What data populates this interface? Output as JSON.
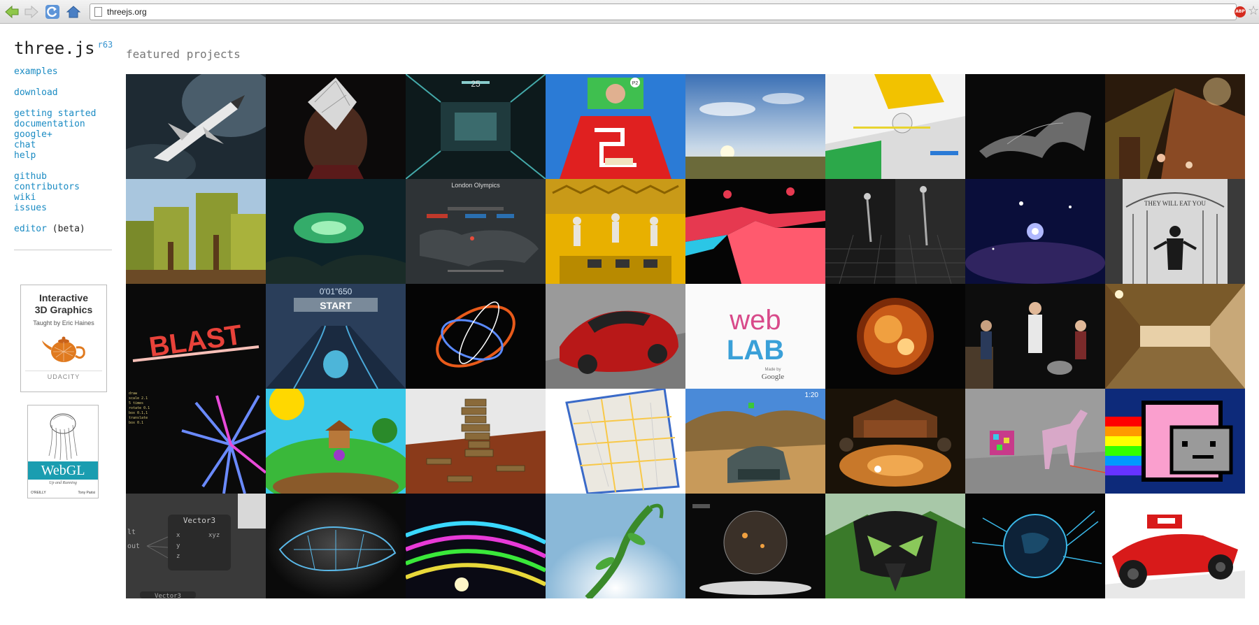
{
  "browser": {
    "url": "threejs.org",
    "abp_label": "ABP"
  },
  "sidebar": {
    "logo": "three.js",
    "version": "r63",
    "links": {
      "examples": "examples",
      "download": "download",
      "getting_started": "getting started",
      "documentation": "documentation",
      "google_plus": "google+",
      "chat": "chat",
      "help": "help",
      "github": "github",
      "contributors": "contributors",
      "wiki": "wiki",
      "issues": "issues",
      "editor": "editor",
      "editor_suffix": "(beta)"
    },
    "udacity": {
      "title_line1": "Interactive",
      "title_line2": "3D Graphics",
      "subtitle": "Taught by Eric Haines",
      "brand": "UDACITY"
    },
    "webgl_book": {
      "title": "WebGL",
      "subtitle": "Up and Running",
      "publisher": "O'REILLY",
      "author": "Tony Parisi"
    }
  },
  "main": {
    "title": "featured projects"
  },
  "tiles": {
    "t2_3_title": "London Olympics",
    "t3_2_text": "0'01\"650",
    "t3_2_start": "START",
    "t3_1_blast": "BLAST",
    "t3_5_web": "web",
    "t3_5_lab": "LAB",
    "t3_5_made": "Made by",
    "t3_5_google": "Google",
    "t4_5_timer": "1:20",
    "t5_1_title": "Vector3",
    "t5_1_x": "x",
    "t5_1_y": "y",
    "t5_1_z": "z",
    "t5_1_xyz": "xyz",
    "t5_1_out": "out",
    "t5_1_lt": "lt",
    "t5_1_bottom": "Vector3",
    "t2_8_text": "THEY WILL EAT YOU",
    "t1_3_num": "25",
    "t1_4_p2": "P2"
  }
}
